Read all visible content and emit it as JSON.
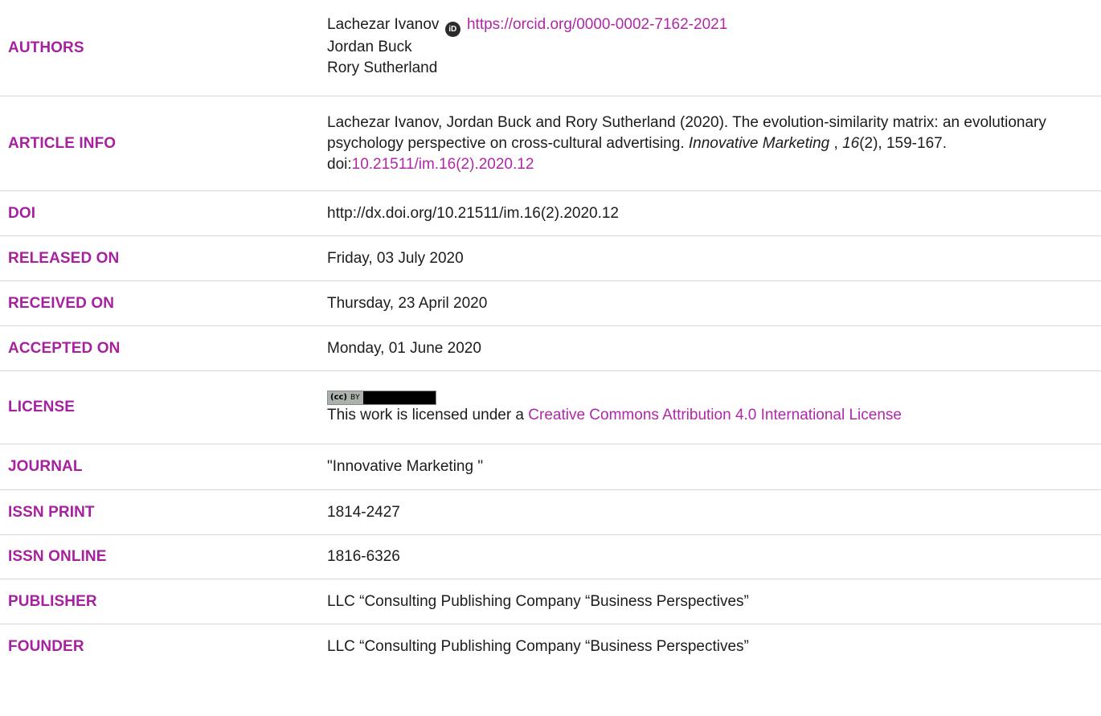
{
  "rows": {
    "authors": {
      "label": "AUTHORS",
      "names": [
        "Lachezar Ivanov",
        "Jordan Buck",
        "Rory Sutherland"
      ],
      "orcid_icon": "orcid-icon",
      "orcid_glyph": "iD",
      "orcid_url": "https://orcid.org/0000-0002-7162-2021"
    },
    "article_info": {
      "label": "ARTICLE INFO",
      "citation_prefix": "Lachezar Ivanov, Jordan Buck and Rory Sutherland (2020). The evolution-similarity matrix: an evolutionary psychology perspective on cross-cultural advertising. ",
      "journal_italic": "Innovative Marketing",
      "sep": " , ",
      "volume_italic": "16",
      "issue_pages": "(2), 159-167.",
      "doi_prefix": "doi:",
      "doi_link": "10.21511/im.16(2).2020.12"
    },
    "doi": {
      "label": "DOI",
      "value": "http://dx.doi.org/10.21511/im.16(2).2020.12"
    },
    "released_on": {
      "label": "RELEASED ON",
      "value": "Friday, 03 July 2020"
    },
    "received_on": {
      "label": "RECEIVED ON",
      "value": "Thursday, 23 April 2020"
    },
    "accepted_on": {
      "label": "ACCEPTED ON",
      "value": "Monday, 01 June 2020"
    },
    "license": {
      "label": "LICENSE",
      "badge_cc": "(cc)",
      "badge_by": "BY",
      "text_prefix": "This work is licensed under a ",
      "link_text": "Creative Commons Attribution 4.0 International License"
    },
    "journal": {
      "label": "JOURNAL",
      "value": "\"Innovative Marketing \""
    },
    "issn_print": {
      "label": "ISSN PRINT",
      "value": "1814-2427"
    },
    "issn_online": {
      "label": "ISSN ONLINE",
      "value": "1816-6326"
    },
    "publisher": {
      "label": "PUBLISHER",
      "value": "LLC “Consulting Publishing Company “Business Perspectives”"
    },
    "founder": {
      "label": "FOUNDER",
      "value": "LLC “Consulting Publishing Company “Business Perspectives”"
    }
  },
  "colors": {
    "label": "#a6219f",
    "link": "#b027a8",
    "text": "#1c1c1c",
    "divider": "#d6d6d6"
  }
}
